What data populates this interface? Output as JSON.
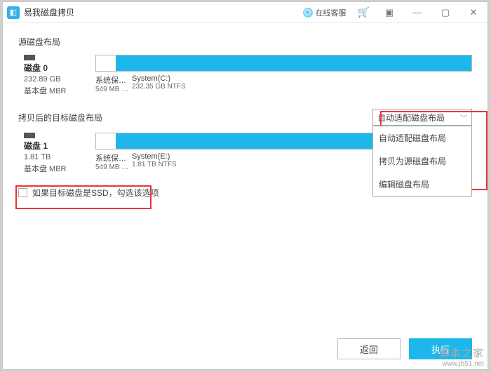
{
  "titlebar": {
    "title": "易我磁盘拷贝",
    "support": "在线客服"
  },
  "source": {
    "label": "源磁盘布局",
    "disk": {
      "name": "磁盘 0",
      "size": "232.89 GB",
      "type": "基本盘 MBR"
    },
    "part_sys": {
      "name": "系统保…",
      "detail": "549 MB …"
    },
    "part_main": {
      "name": "System(C:)",
      "detail": "232.35 GB NTFS"
    }
  },
  "target": {
    "label": "拷贝后的目标磁盘布局",
    "disk": {
      "name": "磁盘 1",
      "size": "1.81 TB",
      "type": "基本盘 MBR"
    },
    "part_sys": {
      "name": "系统保…",
      "detail": "549 MB …"
    },
    "part_main": {
      "name": "System(E:)",
      "detail": "1.81 TB NTFS"
    }
  },
  "layout_mode": {
    "selected": "自动适配磁盘布局",
    "options": [
      "自动适配磁盘布局",
      "拷贝为源磁盘布局",
      "编辑磁盘布局"
    ]
  },
  "ssd_checkbox": "如果目标磁盘是SSD，勾选该选项",
  "buttons": {
    "back": "返回",
    "execute": "执行"
  },
  "watermark": {
    "name": "脚本之家",
    "url": "www.jb51.net"
  }
}
